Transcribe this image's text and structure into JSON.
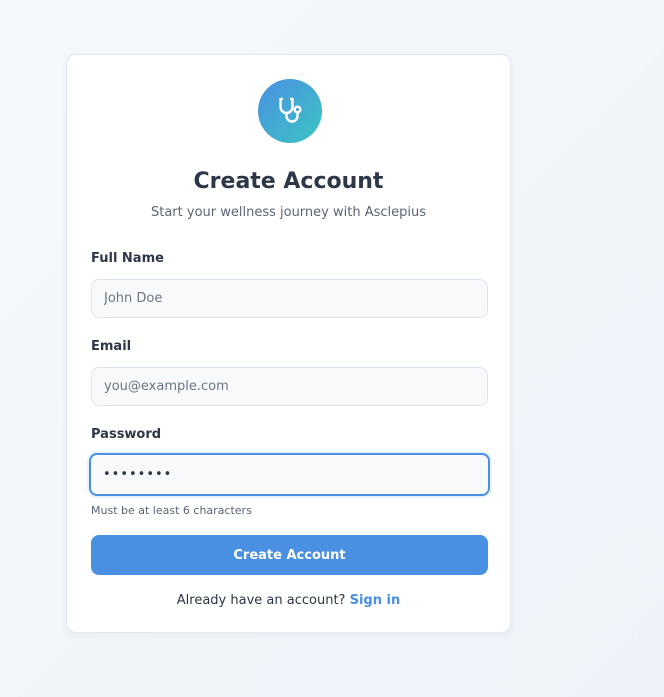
{
  "brand": {
    "logo_icon": "stethoscope-icon",
    "accent_color": "#4a90e2",
    "gradient_end": "#3cc4c2"
  },
  "header": {
    "title": "Create Account",
    "subtitle": "Start your wellness journey with Asclepius"
  },
  "form": {
    "full_name": {
      "label": "Full Name",
      "placeholder": "John Doe",
      "value": ""
    },
    "email": {
      "label": "Email",
      "placeholder": "you@example.com",
      "value": ""
    },
    "password": {
      "label": "Password",
      "value": "••••••••",
      "hint": "Must be at least 6 characters",
      "focused": true
    },
    "submit_label": "Create Account"
  },
  "footer": {
    "prompt": "Already have an account?",
    "link_label": "Sign in"
  }
}
